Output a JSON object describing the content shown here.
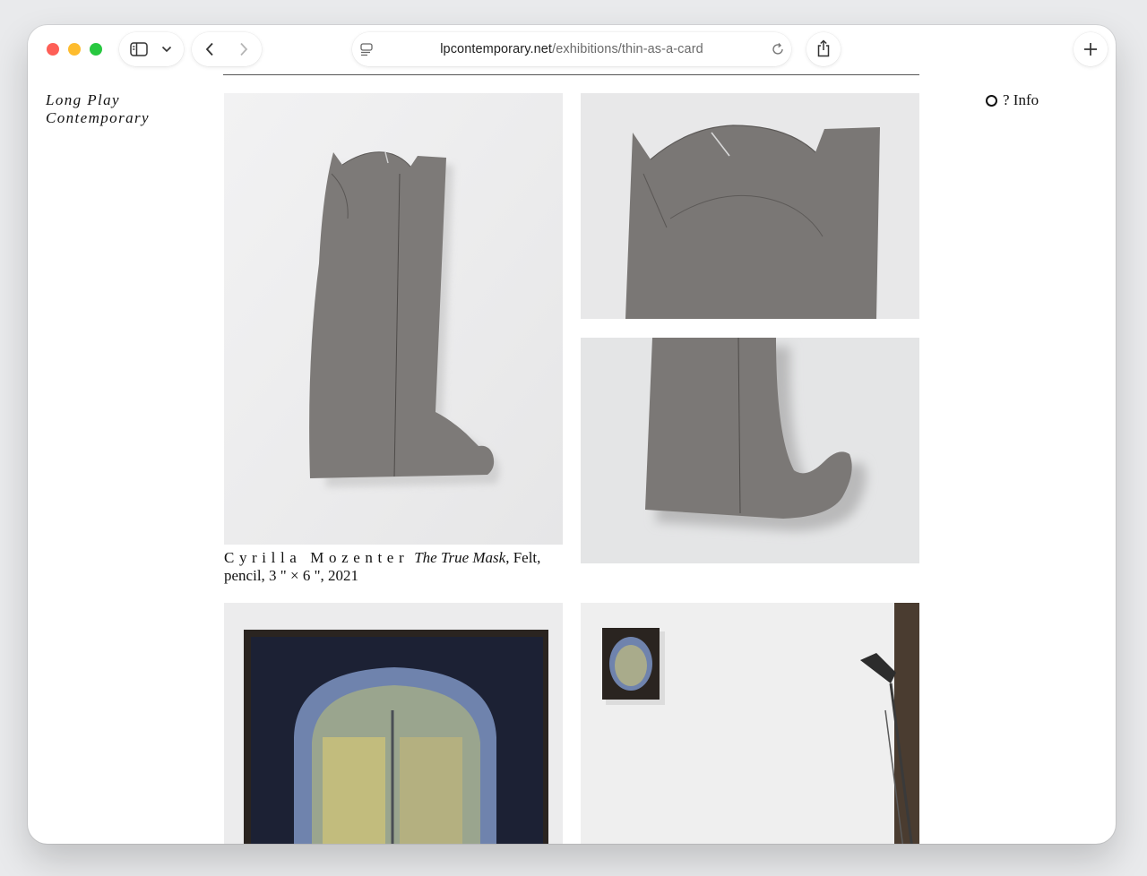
{
  "browser": {
    "url_domain": "lpcontemporary.net",
    "url_path": "/exhibitions/thin-as-a-card"
  },
  "site": {
    "title_line1": "Long Play",
    "title_line2": "Contemporary",
    "info_label": "? Info"
  },
  "artwork": {
    "artist": "Cyrilla Mozenter",
    "title": "The True Mask",
    "details": ", Felt, pencil, 3 \" × 6 \", 2021"
  },
  "colors": {
    "felt": "#7d7a78",
    "wall": "#efefef",
    "canvas_dark": "#2a2420",
    "canvas_blue": "#7b8db2",
    "canvas_yellow": "#c9bf7a"
  }
}
